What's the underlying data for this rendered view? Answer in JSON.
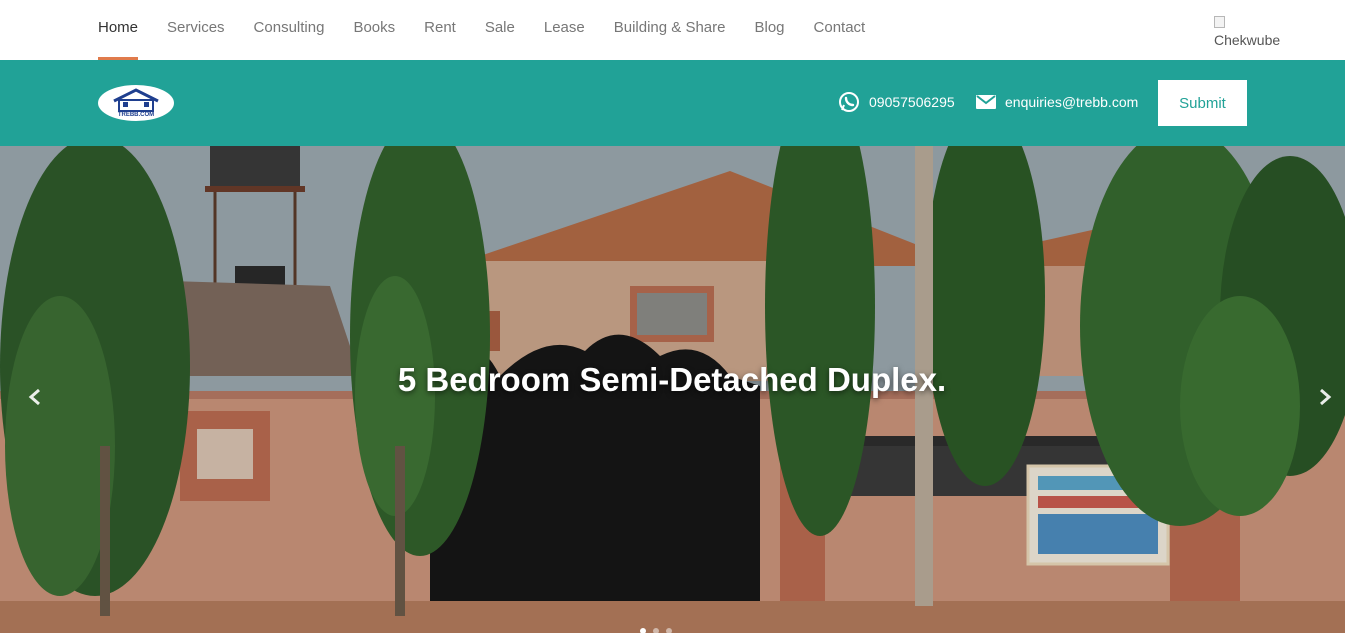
{
  "nav": {
    "items": [
      {
        "label": "Home"
      },
      {
        "label": "Services"
      },
      {
        "label": "Consulting"
      },
      {
        "label": "Books"
      },
      {
        "label": "Rent"
      },
      {
        "label": "Sale"
      },
      {
        "label": "Lease"
      },
      {
        "label": "Building & Share"
      },
      {
        "label": "Blog"
      },
      {
        "label": "Contact"
      }
    ],
    "active_index": 0,
    "user_image_alt": "Chekwube"
  },
  "header": {
    "logo_icon": "house-logo-icon",
    "logo_text": "TREBB.COM",
    "phone": "09057506295",
    "phone_icon": "whatsapp-icon",
    "email": "enquiries@trebb.com",
    "email_icon": "mail-icon",
    "submit_label": "Submit"
  },
  "hero": {
    "title": "5 Bedroom Semi-Detached Duplex.",
    "prev_icon": "chevron-left-icon",
    "next_icon": "chevron-right-icon",
    "slide_count": 3,
    "active_slide": 0
  },
  "colors": {
    "brand_teal": "#21a297",
    "active_underline": "#e07b4c",
    "nav_text": "#777777",
    "nav_active_text": "#333333"
  }
}
